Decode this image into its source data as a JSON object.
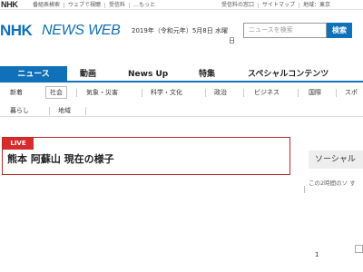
{
  "utility_bar": {
    "logo": "NHK",
    "left_links": [
      "番組表検索",
      "ウェブで視聴",
      "受信料",
      "…もっと"
    ],
    "right_links": [
      "受信料の窓口",
      "サイトマップ",
      "地域：東京"
    ]
  },
  "header": {
    "logo": "NHK",
    "site_name": "NEWS WEB",
    "date_line1": "2019年（令和元年）5月8日 水曜",
    "date_line2": "日",
    "search_placeholder": "ニュースを検索",
    "search_button": "検索"
  },
  "primary_nav": [
    {
      "label": "ニュース",
      "active": true
    },
    {
      "label": "動画",
      "active": false
    },
    {
      "label": "News Up",
      "active": false
    },
    {
      "label": "特集",
      "active": false
    },
    {
      "label": "スペシャルコンテンツ",
      "active": false
    }
  ],
  "sub_nav": {
    "row1": [
      "新着",
      "社会",
      "気象・災害",
      "科学・文化",
      "政治",
      "ビジネス",
      "国際",
      "スポ"
    ],
    "row2": [
      "暮らし",
      "地域"
    ],
    "active": "社会"
  },
  "live": {
    "badge": "LIVE",
    "title": "熊本 阿蘇山 現在の様子"
  },
  "social": {
    "heading": "ソーシャル",
    "sub": "この2時間のソ す",
    "number": "1"
  },
  "colors": {
    "brand": "#1070b8",
    "live_red": "#d82c2c"
  }
}
